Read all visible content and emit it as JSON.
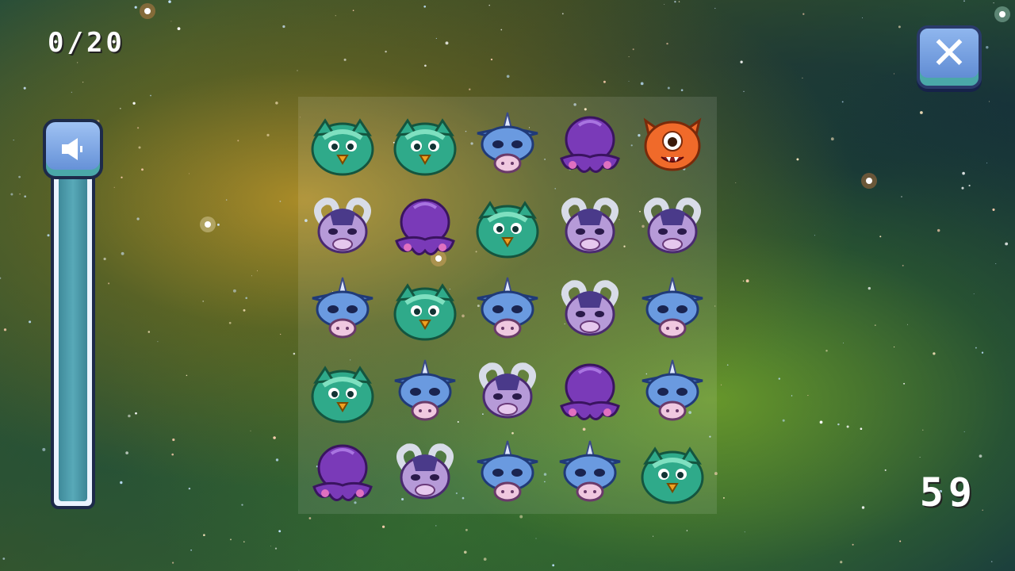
{
  "hud": {
    "pairs_counter": "0/20",
    "timer": "59",
    "volume_level": 0.97
  },
  "icons": {
    "close": "close-icon",
    "volume": "speaker-icon"
  },
  "colors": {
    "button_blue": "#6f9be0",
    "button_border": "#1d2a4a",
    "slider_fill": "#4a9aaa",
    "text": "#ffffff"
  },
  "board": {
    "rows": 5,
    "cols": 5,
    "tiles": [
      [
        "green-owl-monster",
        "green-owl-monster",
        "blue-unicorn-monster",
        "purple-octopus-monster",
        "orange-cyclops-cat-monster"
      ],
      [
        "purple-ram-monster",
        "purple-octopus-monster",
        "green-owl-monster",
        "purple-ram-monster",
        "purple-ram-monster"
      ],
      [
        "blue-unicorn-monster",
        "green-owl-monster",
        "blue-unicorn-monster",
        "purple-ram-monster",
        "blue-unicorn-monster"
      ],
      [
        "green-owl-monster",
        "blue-unicorn-monster",
        "purple-ram-monster",
        "purple-octopus-monster",
        "blue-unicorn-monster"
      ],
      [
        "purple-octopus-monster",
        "purple-ram-monster",
        "blue-unicorn-monster",
        "blue-unicorn-monster",
        "green-owl-monster"
      ]
    ]
  }
}
